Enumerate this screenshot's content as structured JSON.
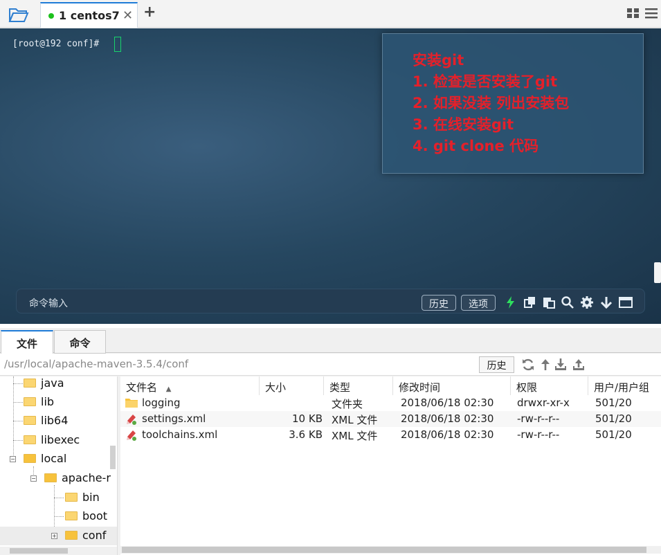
{
  "session_tab": {
    "title": "1 centos7",
    "close": "✕",
    "add": "+"
  },
  "terminal": {
    "prompt": "[root@192 conf]#",
    "note_lines": [
      "安装git",
      "1. 检查是否安装了git",
      "2. 如果没装 列出安装包",
      "3. 在线安装git",
      "4. git clone 代码"
    ],
    "note_color": "#e5202a",
    "command_placeholder": "命令输入",
    "history_button": "历史",
    "options_button": "选项"
  },
  "lower_tabs": {
    "files": "文件",
    "commands": "命令"
  },
  "pathbar": {
    "path": "/usr/local/apache-maven-3.5.4/conf",
    "history_button": "历史"
  },
  "tree": {
    "items": [
      {
        "label": "java"
      },
      {
        "label": "lib"
      },
      {
        "label": "lib64"
      },
      {
        "label": "libexec"
      },
      {
        "label": "local"
      },
      {
        "label": "apache-r"
      },
      {
        "label": "bin"
      },
      {
        "label": "boot"
      },
      {
        "label": "conf"
      }
    ]
  },
  "file_table": {
    "headers": {
      "name": "文件名",
      "sort_arrow": "▲",
      "size": "大小",
      "type": "类型",
      "mtime": "修改时间",
      "perm": "权限",
      "owner": "用户/用户组"
    },
    "rows": [
      {
        "icon": "folder-icon",
        "name": "logging",
        "size": "",
        "type": "文件夹",
        "mtime": "2018/06/18 02:30",
        "perm": "drwxr-xr-x",
        "owner": "501/20"
      },
      {
        "icon": "xml-file-icon",
        "name": "settings.xml",
        "size": "10 KB",
        "type": "XML 文件",
        "mtime": "2018/06/18 02:30",
        "perm": "-rw-r--r--",
        "owner": "501/20"
      },
      {
        "icon": "xml-file-icon",
        "name": "toolchains.xml",
        "size": "3.6 KB",
        "type": "XML 文件",
        "mtime": "2018/06/18 02:30",
        "perm": "-rw-r--r--",
        "owner": "501/20"
      }
    ]
  }
}
